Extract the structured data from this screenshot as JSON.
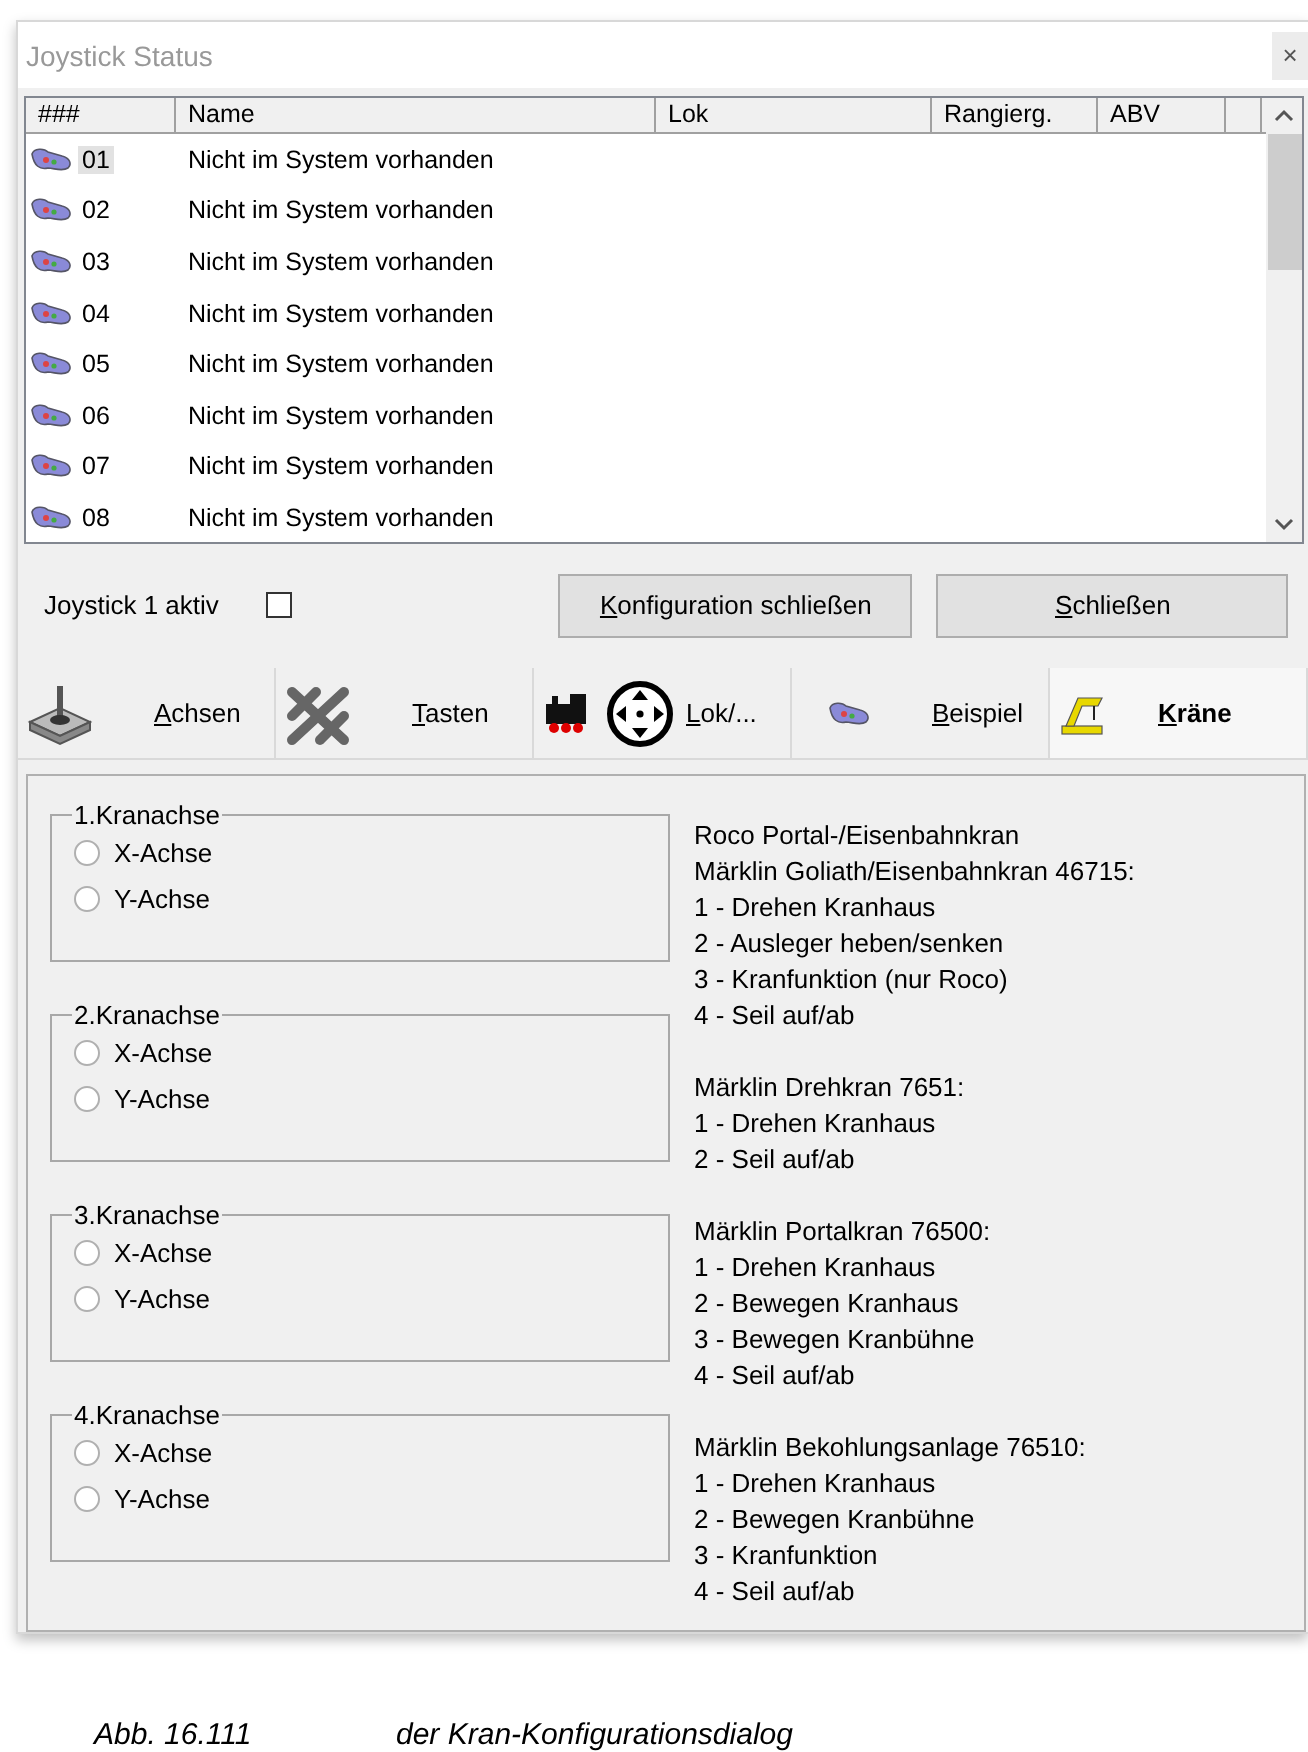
{
  "window": {
    "title": "Joystick Status",
    "close_glyph": "×"
  },
  "table": {
    "columns": [
      "###",
      "Name",
      "Lok",
      "Rangierg.",
      "ABV"
    ],
    "rows": [
      {
        "number": "01",
        "name": "Nicht im System vorhanden",
        "selected": true
      },
      {
        "number": "02",
        "name": "Nicht im System vorhanden",
        "selected": false
      },
      {
        "number": "03",
        "name": "Nicht im System vorhanden",
        "selected": false
      },
      {
        "number": "04",
        "name": "Nicht im System vorhanden",
        "selected": false
      },
      {
        "number": "05",
        "name": "Nicht im System vorhanden",
        "selected": false
      },
      {
        "number": "06",
        "name": "Nicht im System vorhanden",
        "selected": false
      },
      {
        "number": "07",
        "name": "Nicht im System vorhanden",
        "selected": false
      },
      {
        "number": "08",
        "name": "Nicht im System vorhanden",
        "selected": false
      }
    ]
  },
  "active_checkbox": {
    "label": "Joystick 1 aktiv",
    "checked": false
  },
  "buttons": [
    "Konfiguration schließen",
    "Schließen"
  ],
  "tabs": [
    {
      "label": "Achsen",
      "kind": "joystick",
      "selected": false
    },
    {
      "label": "Tasten",
      "kind": "keys",
      "selected": false
    },
    {
      "label": "Lok/...",
      "kind": "loco",
      "selected": false
    },
    {
      "label": "Beispiel",
      "kind": "gamepad",
      "selected": false
    },
    {
      "label": "Kräne",
      "kind": "crane",
      "selected": true
    }
  ],
  "axis_groups": [
    {
      "title": "1.Kranachse",
      "options": [
        {
          "label": "X-Achse",
          "selected": false
        },
        {
          "label": "Y-Achse",
          "selected": false
        }
      ]
    },
    {
      "title": "2.Kranachse",
      "options": [
        {
          "label": "X-Achse",
          "selected": false
        },
        {
          "label": "Y-Achse",
          "selected": false
        }
      ]
    },
    {
      "title": "3.Kranachse",
      "options": [
        {
          "label": "X-Achse",
          "selected": false
        },
        {
          "label": "Y-Achse",
          "selected": false
        }
      ]
    },
    {
      "title": "4.Kranachse",
      "options": [
        {
          "label": "X-Achse",
          "selected": false
        },
        {
          "label": "Y-Achse",
          "selected": false
        }
      ]
    }
  ],
  "crane_info": [
    [
      "Roco Portal-/Eisenbahnkran",
      "Märklin Goliath/Eisenbahnkran 46715:",
      "1 - Drehen Kranhaus",
      "2 - Ausleger heben/senken",
      "3 - Kranfunktion (nur Roco)",
      "4 - Seil auf/ab"
    ],
    [
      "Märklin Drehkran 7651:",
      "1 - Drehen Kranhaus",
      "2 - Seil auf/ab"
    ],
    [
      "Märklin Portalkran 76500:",
      "1 - Drehen Kranhaus",
      "2 - Bewegen Kranhaus",
      "3 - Bewegen Kranbühne",
      "4 - Seil auf/ab"
    ],
    [
      "Märklin Bekohlungsanlage 76510:",
      "1 - Drehen Kranhaus",
      "2 - Bewegen Kranbühne",
      "3 - Kranfunktion",
      "4 - Seil auf/ab"
    ]
  ],
  "caption": {
    "number": "Abb. 16.111",
    "text": "der Kran-Konfigurationsdialog"
  }
}
